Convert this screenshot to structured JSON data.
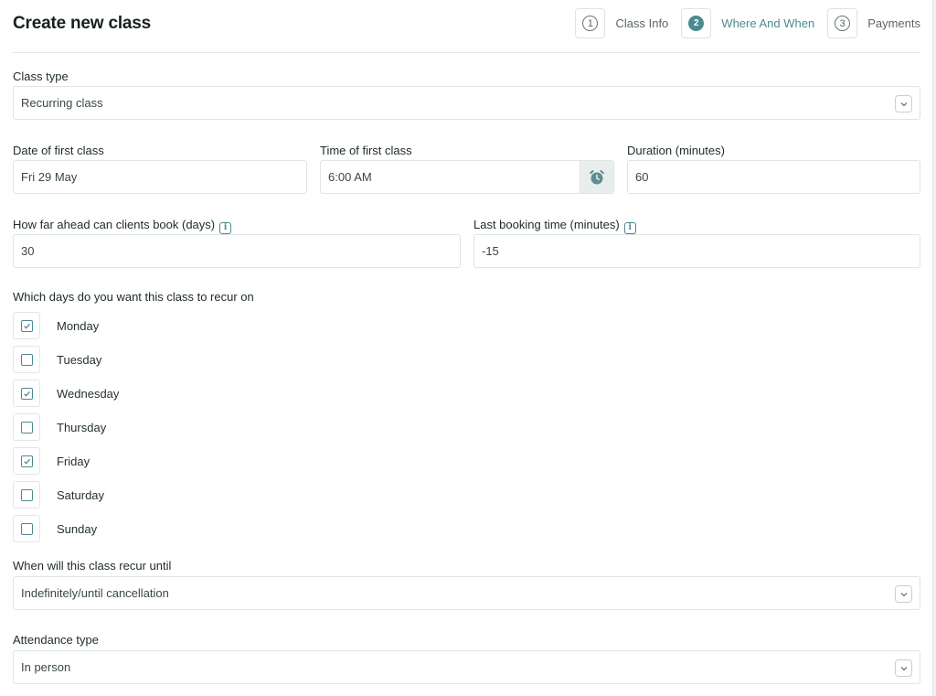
{
  "header": {
    "title": "Create new class",
    "steps": [
      {
        "number": "1",
        "label": "Class Info",
        "active": false
      },
      {
        "number": "2",
        "label": "Where And When",
        "active": true
      },
      {
        "number": "3",
        "label": "Payments",
        "active": false
      }
    ]
  },
  "form": {
    "class_type": {
      "label": "Class type",
      "value": "Recurring class"
    },
    "date_first": {
      "label": "Date of first class",
      "value": "Fri 29 May"
    },
    "time_first": {
      "label": "Time of first class",
      "value": "6:00 AM"
    },
    "duration": {
      "label": "Duration (minutes)",
      "value": "60"
    },
    "book_ahead": {
      "label": "How far ahead can clients book (days)",
      "value": "30"
    },
    "last_booking": {
      "label": "Last booking time (minutes)",
      "value": "-15"
    },
    "days": {
      "label": "Which days do you want this class to recur on",
      "items": [
        {
          "label": "Monday",
          "checked": true
        },
        {
          "label": "Tuesday",
          "checked": false
        },
        {
          "label": "Wednesday",
          "checked": true
        },
        {
          "label": "Thursday",
          "checked": false
        },
        {
          "label": "Friday",
          "checked": true
        },
        {
          "label": "Saturday",
          "checked": false
        },
        {
          "label": "Sunday",
          "checked": false
        }
      ]
    },
    "recur_until": {
      "label": "When will this class recur until",
      "value": "Indefinitely/until cancellation"
    },
    "attendance": {
      "label": "Attendance type",
      "value": "In person"
    }
  },
  "colors": {
    "accent": "#4b8b90",
    "border": "#dfe4e4"
  }
}
